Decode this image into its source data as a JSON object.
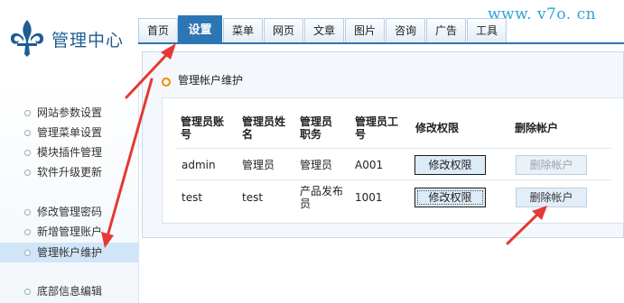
{
  "brand": {
    "title": "管理中心",
    "watermark": "www. v7o. cn"
  },
  "tabs": [
    {
      "label": "首页",
      "active": false
    },
    {
      "label": "设置",
      "active": true
    },
    {
      "label": "菜单",
      "active": false
    },
    {
      "label": "网页",
      "active": false
    },
    {
      "label": "文章",
      "active": false
    },
    {
      "label": "图片",
      "active": false
    },
    {
      "label": "咨询",
      "active": false
    },
    {
      "label": "广告",
      "active": false
    },
    {
      "label": "工具",
      "active": false
    }
  ],
  "sidebar": {
    "items": [
      {
        "label": "网站参数设置"
      },
      {
        "label": "管理菜单设置"
      },
      {
        "label": "模块插件管理"
      },
      {
        "label": "软件升级更新"
      },
      {
        "label": "修改管理密码"
      },
      {
        "label": "新增管理账户"
      },
      {
        "label": "管理帐户维护",
        "active": true
      },
      {
        "label": "底部信息编辑"
      }
    ]
  },
  "main": {
    "section_title": "管理帐户维护",
    "table": {
      "headers": [
        "管理员账号",
        "管理员姓名",
        "管理员职务",
        "管理员工号",
        "修改权限",
        "删除帐户"
      ],
      "rows": [
        {
          "account": "admin",
          "name": "管理员",
          "position": "管理员",
          "id": "A001",
          "edit": "修改权限",
          "delete": "删除帐户",
          "delete_disabled": true
        },
        {
          "account": "test",
          "name": "test",
          "position": "产品发布员",
          "id": "1001",
          "edit": "修改权限",
          "delete": "删除帐户",
          "delete_disabled": false
        }
      ]
    }
  },
  "colors": {
    "accent": "#2d76b4",
    "arrow": "#e53935",
    "bullet_orange": "#f08a00",
    "watermark": "#2ea3d2"
  }
}
